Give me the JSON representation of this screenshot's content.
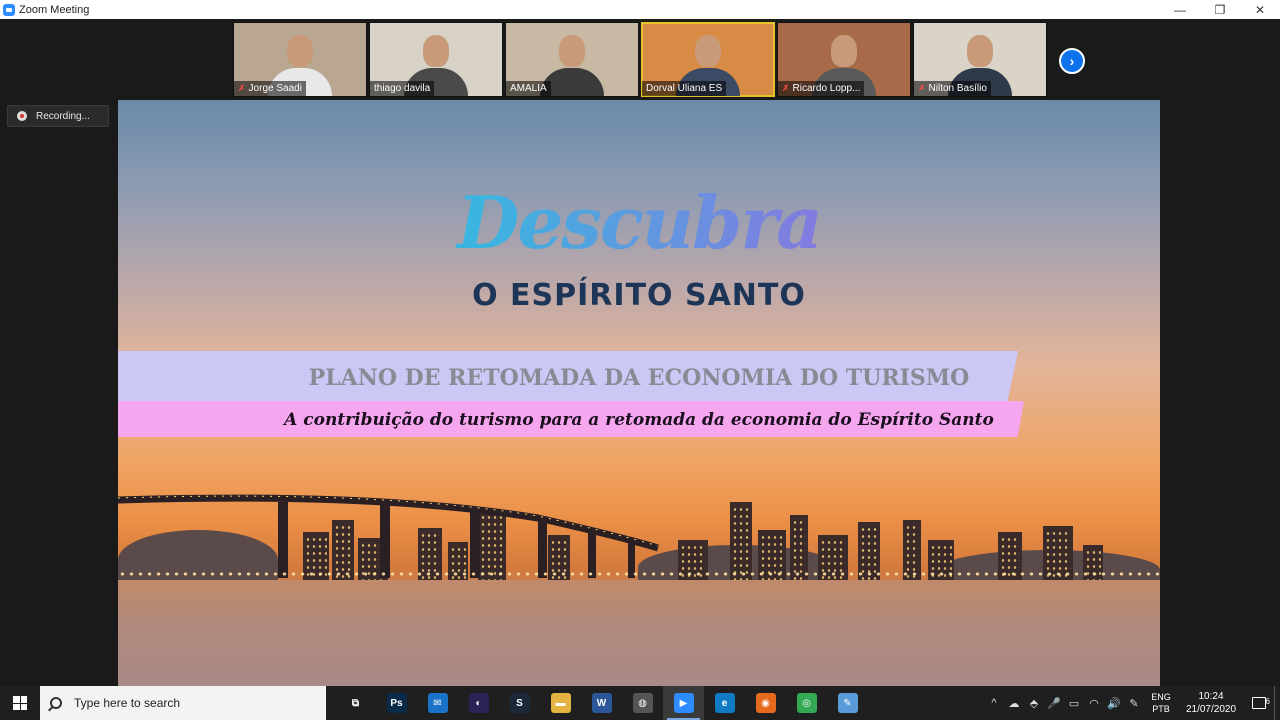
{
  "window": {
    "title": "Zoom Meeting",
    "controls": [
      "—",
      "❐",
      "✕"
    ]
  },
  "participants": [
    {
      "name": "Jorge Saadi",
      "muted": true,
      "bg": "#b9a792",
      "shirt": "#e8e8e8"
    },
    {
      "name": "thiago davila",
      "muted": false,
      "bg": "#d8d2c7",
      "shirt": "#4a4a4a"
    },
    {
      "name": "AMALIA",
      "muted": false,
      "bg": "#c7b9a4",
      "shirt": "#3a3a3a"
    },
    {
      "name": "Dorval Uliana ES",
      "muted": false,
      "bg": "#d78b44",
      "shirt": "#3c4a66",
      "active": true
    },
    {
      "name": "Ricardo Lopp...",
      "muted": true,
      "bg": "#a96a4a",
      "shirt": "#5a5a5a"
    },
    {
      "name": "Nilton Basílio",
      "muted": true,
      "bg": "#d9d3c8",
      "shirt": "#2f3a4a"
    }
  ],
  "recording": {
    "label": "Recording..."
  },
  "slide": {
    "title_script": "Descubra",
    "title_sub": "O ESPÍRITO SANTO",
    "band1": "PLANO DE RETOMADA DA ECONOMIA DO TURISMO",
    "band2": "A contribuição do turismo para a retomada da economia do Espírito Santo"
  },
  "taskbar": {
    "search_placeholder": "Type here to search",
    "apps": [
      {
        "name": "task-view",
        "label": "⧉",
        "color": "transparent"
      },
      {
        "name": "photoshop",
        "label": "Ps",
        "color": "#0a2a4a"
      },
      {
        "name": "mail",
        "label": "✉",
        "color": "#1a73c8"
      },
      {
        "name": "eclipse",
        "label": "◐",
        "color": "#2c2255"
      },
      {
        "name": "steam",
        "label": "S",
        "color": "#1b2838"
      },
      {
        "name": "file-explorer",
        "label": "▬",
        "color": "#e3b341"
      },
      {
        "name": "word",
        "label": "W",
        "color": "#2b579a"
      },
      {
        "name": "globe-app",
        "label": "◍",
        "color": "#555555"
      },
      {
        "name": "zoom",
        "label": "▶",
        "color": "#2d8cff",
        "active": true
      },
      {
        "name": "edge",
        "label": "e",
        "color": "#0f7bc4"
      },
      {
        "name": "firefox",
        "label": "◉",
        "color": "#e66a1e"
      },
      {
        "name": "chrome",
        "label": "◎",
        "color": "#34a853"
      },
      {
        "name": "paint-app",
        "label": "✎",
        "color": "#5a9ad8"
      }
    ],
    "tray_icons": [
      "^",
      "☁",
      "⬘",
      "🎤",
      "▭",
      "◠",
      "🔊",
      "✎"
    ],
    "lang_top": "ENG",
    "lang_bottom": "PTB",
    "time": "10:24",
    "date": "21/07/2020",
    "notif_count": "6"
  }
}
